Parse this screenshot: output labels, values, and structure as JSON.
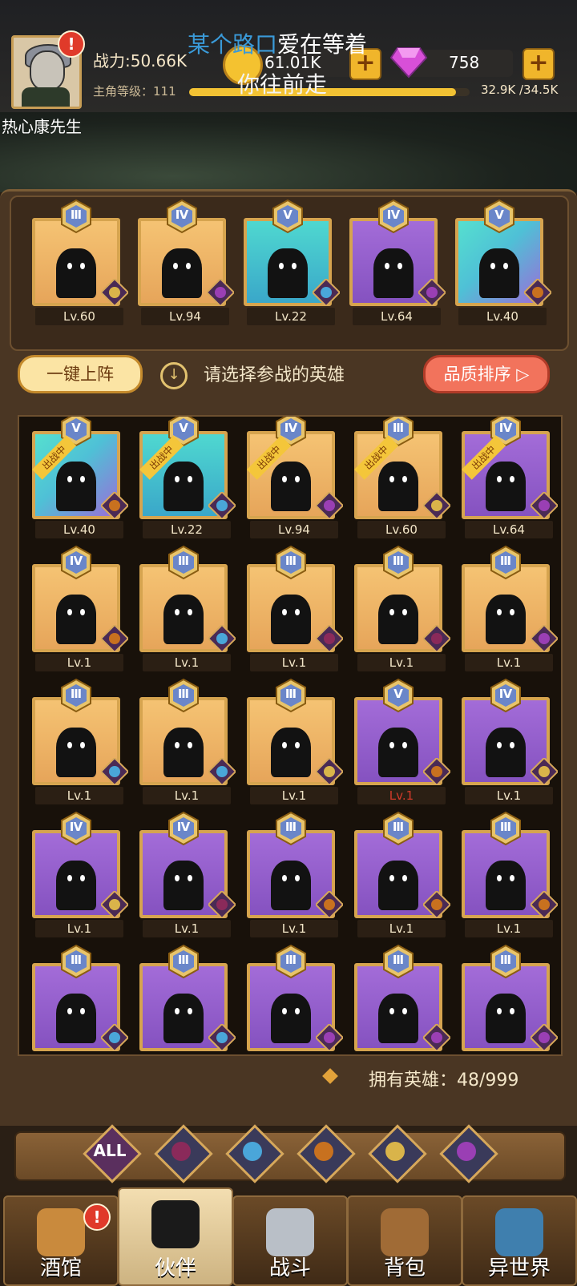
{
  "header": {
    "power_label": "战力:50.66K",
    "level_label": "主角等级：111",
    "xp_text": "32.9K /34.5K",
    "xp_fraction": 0.95,
    "coins": "61.01K",
    "gems": "758",
    "overlay_line1_a": "某个路口",
    "overlay_line1_b": "爱在等着",
    "overlay_line2": "你往前走",
    "nickname": "热心康先生",
    "alert_mark": "!"
  },
  "team": [
    {
      "rank": "Ⅲ",
      "level": "Lv.60",
      "color": "orange",
      "faction": "elf"
    },
    {
      "rank": "Ⅳ",
      "level": "Lv.94",
      "color": "orange",
      "faction": "demon"
    },
    {
      "rank": "Ⅴ",
      "level": "Lv.22",
      "color": "teal",
      "faction": "fish"
    },
    {
      "rank": "Ⅳ",
      "level": "Lv.64",
      "color": "purple",
      "faction": "demon"
    },
    {
      "rank": "Ⅴ",
      "level": "Lv.40",
      "color": "teal-purple",
      "faction": "lion"
    }
  ],
  "controls": {
    "one_key_label": "一键上阵",
    "hint": "请选择参战的英雄",
    "quality_sort_label": "品质排序 ▷",
    "info_icon": "↓"
  },
  "in_battle_label": "出战中",
  "heroes": [
    {
      "rank": "Ⅴ",
      "level": "Lv.40",
      "color": "teal-purple",
      "faction": "lion",
      "in_battle": true
    },
    {
      "rank": "Ⅴ",
      "level": "Lv.22",
      "color": "teal",
      "faction": "fish",
      "in_battle": true
    },
    {
      "rank": "Ⅳ",
      "level": "Lv.94",
      "color": "orange",
      "faction": "demon",
      "in_battle": true
    },
    {
      "rank": "Ⅲ",
      "level": "Lv.60",
      "color": "orange",
      "faction": "elf",
      "in_battle": true
    },
    {
      "rank": "Ⅳ",
      "level": "Lv.64",
      "color": "purple",
      "faction": "demon",
      "in_battle": true
    },
    {
      "rank": "Ⅳ",
      "level": "Lv.1",
      "color": "orange",
      "faction": "lion"
    },
    {
      "rank": "Ⅲ",
      "level": "Lv.1",
      "color": "orange",
      "faction": "fish"
    },
    {
      "rank": "Ⅲ",
      "level": "Lv.1",
      "color": "orange",
      "faction": "knight"
    },
    {
      "rank": "Ⅲ",
      "level": "Lv.1",
      "color": "orange",
      "faction": "knight"
    },
    {
      "rank": "Ⅲ",
      "level": "Lv.1",
      "color": "orange",
      "faction": "demon"
    },
    {
      "rank": "Ⅲ",
      "level": "Lv.1",
      "color": "orange",
      "faction": "fish"
    },
    {
      "rank": "Ⅲ",
      "level": "Lv.1",
      "color": "orange",
      "faction": "fish"
    },
    {
      "rank": "Ⅲ",
      "level": "Lv.1",
      "color": "orange",
      "faction": "elf"
    },
    {
      "rank": "Ⅴ",
      "level": "Lv.1",
      "color": "purple",
      "faction": "lion",
      "red": true
    },
    {
      "rank": "Ⅳ",
      "level": "Lv.1",
      "color": "purple",
      "faction": "elf"
    },
    {
      "rank": "Ⅳ",
      "level": "Lv.1",
      "color": "purple",
      "faction": "elf"
    },
    {
      "rank": "Ⅳ",
      "level": "Lv.1",
      "color": "purple",
      "faction": "knight"
    },
    {
      "rank": "Ⅲ",
      "level": "Lv.1",
      "color": "purple",
      "faction": "lion"
    },
    {
      "rank": "Ⅲ",
      "level": "Lv.1",
      "color": "purple",
      "faction": "lion"
    },
    {
      "rank": "Ⅲ",
      "level": "Lv.1",
      "color": "purple",
      "faction": "lion"
    },
    {
      "rank": "Ⅲ",
      "level": "",
      "color": "purple",
      "faction": "fish"
    },
    {
      "rank": "Ⅲ",
      "level": "",
      "color": "purple",
      "faction": "fish"
    },
    {
      "rank": "Ⅲ",
      "level": "",
      "color": "purple",
      "faction": "demon"
    },
    {
      "rank": "Ⅲ",
      "level": "",
      "color": "purple",
      "faction": "demon"
    },
    {
      "rank": "Ⅲ",
      "level": "",
      "color": "purple",
      "faction": "demon"
    }
  ],
  "owned_label": "拥有英雄：48/999",
  "filters": [
    {
      "name": "all",
      "label": "ALL"
    },
    {
      "name": "knight",
      "label": ""
    },
    {
      "name": "fish",
      "label": ""
    },
    {
      "name": "lion",
      "label": ""
    },
    {
      "name": "elf",
      "label": ""
    },
    {
      "name": "demon",
      "label": ""
    }
  ],
  "nav": [
    {
      "name": "tavern",
      "label": "酒馆",
      "alert": true
    },
    {
      "name": "partners",
      "label": "伙伴",
      "active": true
    },
    {
      "name": "battle",
      "label": "战斗"
    },
    {
      "name": "bag",
      "label": "背包"
    },
    {
      "name": "otherworld",
      "label": "异世界"
    }
  ],
  "colors": {
    "orange": "#f0b566",
    "purple": "#9560cc",
    "teal": "#45c9d1",
    "frame": "#d6a44f",
    "accent_red": "#e03a2a"
  }
}
